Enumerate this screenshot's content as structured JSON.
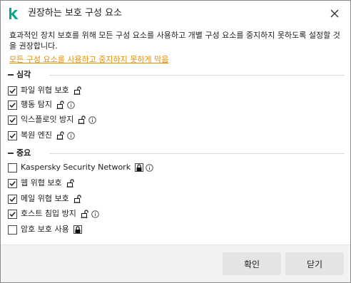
{
  "dialog": {
    "title": "권장하는 보호 구성 요소",
    "description": "효과적인 장치 보호를 위해 모든 구성 요소를 사용하고 개별 구성 요소를 중지하지 못하도록 설정할 것을 권장합니다.",
    "link": "모든 구성 요소를 사용하고 중지하지 못하게 막음"
  },
  "groups": [
    {
      "label": "심각",
      "items": [
        {
          "label": "파일 위협 보호",
          "checked": true,
          "lock": "white",
          "info": false
        },
        {
          "label": "행동 탐지",
          "checked": true,
          "lock": "white",
          "info": true
        },
        {
          "label": "익스플로잇 방지",
          "checked": true,
          "lock": "white",
          "info": true
        },
        {
          "label": "복원 엔진",
          "checked": true,
          "lock": "white",
          "info": true
        }
      ]
    },
    {
      "label": "중요",
      "items": [
        {
          "label": "Kaspersky Security Network",
          "checked": false,
          "lock": "black",
          "info": true
        },
        {
          "label": "웹 위협 보호",
          "checked": true,
          "lock": "white",
          "info": false
        },
        {
          "label": "메일 위협 보호",
          "checked": true,
          "lock": "white",
          "info": false
        },
        {
          "label": "호스트 침입 방지",
          "checked": true,
          "lock": "white",
          "info": true
        },
        {
          "label": "암호 보호 사용",
          "checked": false,
          "lock": "black",
          "info": false
        }
      ]
    }
  ],
  "footer": {
    "ok_label": "확인",
    "close_label": "닫기"
  },
  "colors": {
    "link": "#e88e00",
    "logo": "#00a88e",
    "button_bg": "#e4e4e4",
    "footer_bg": "#f2f2f2"
  }
}
